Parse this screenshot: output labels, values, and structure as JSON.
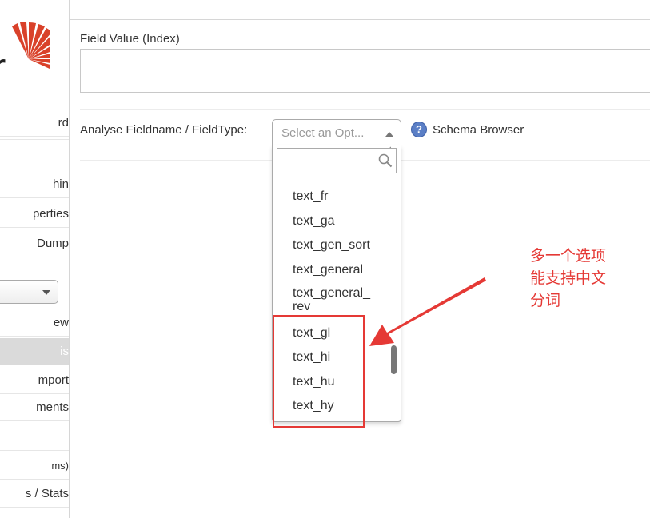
{
  "sidebar": {
    "items": [
      {
        "label": "rd"
      },
      {
        "label": "hin"
      },
      {
        "label": "perties"
      },
      {
        "label": "Dump"
      },
      {
        "label": "ew"
      },
      {
        "label": "is"
      },
      {
        "label": "mport"
      },
      {
        "label": "ments"
      },
      {
        "label": "ms)"
      },
      {
        "label": "s / Stats"
      }
    ]
  },
  "form": {
    "field_value_label": "Field Value (Index)",
    "fieldname_label": "Analyse Fieldname / FieldType:",
    "select_placeholder": "Select an Opt...",
    "schema_browser": "Schema Browser",
    "help_glyph": "?"
  },
  "dropdown": {
    "options": [
      "text_fr",
      "text_ga",
      "text_gen_sort",
      "text_general",
      "text_general_\nrev",
      "text_gl",
      "text_hi",
      "text_hu",
      "text_hy"
    ]
  },
  "annotation": {
    "note": "多一个选项\n能支持中文\n分词",
    "color": "#e53935"
  },
  "colors": {
    "sidebar_active_bg": "#dadada",
    "help_icon": "#5b7fc6",
    "logo": "#d9412a"
  }
}
